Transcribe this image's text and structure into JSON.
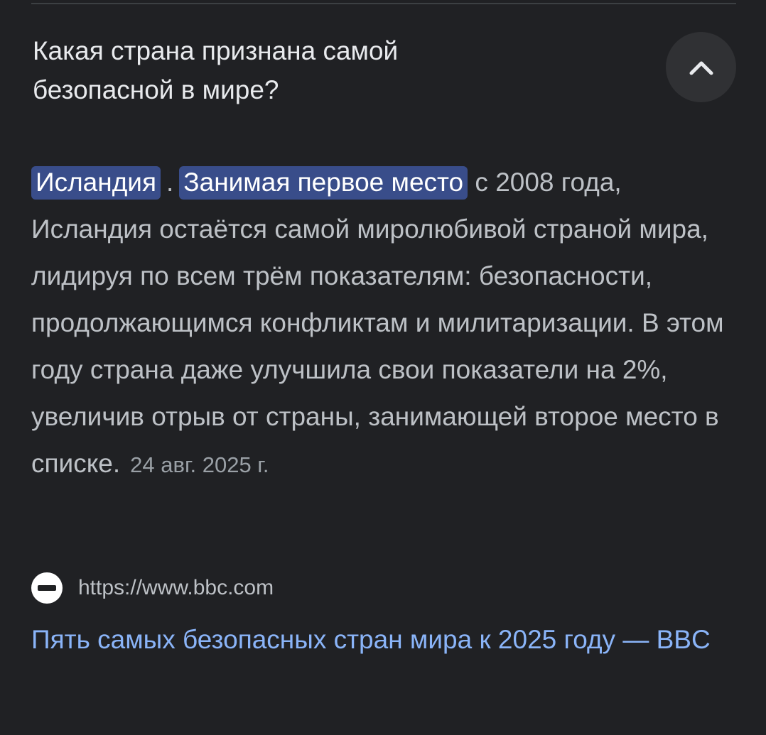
{
  "question": "Какая страна признана самой безопасной в мире?",
  "collapse_icon": "chevron-up-icon",
  "answer": {
    "highlight_country": "Исландия",
    "separator": ".",
    "highlight_phrase": "Занимая первое место",
    "body": " с 2008 года, Исландия остаётся самой миролюбивой страной мира, лидируя по всем трём показателям: безопасности, продолжающимся конфликтам и милитаризации. В этом году страна даже улучшила свои показатели на 2%, увеличив отрыв от страны, занимающей второе место в списке.",
    "date": "24 авг. 2025 г."
  },
  "source": {
    "favicon": "bbc-favicon",
    "url": "https://www.bbc.com",
    "title": "Пять самых безопасных стран мира к 2025 году — BBC"
  },
  "colors": {
    "background": "#202124",
    "highlight": "#394d8a",
    "link": "#8ab4f8",
    "text": "#bdc1c6"
  }
}
